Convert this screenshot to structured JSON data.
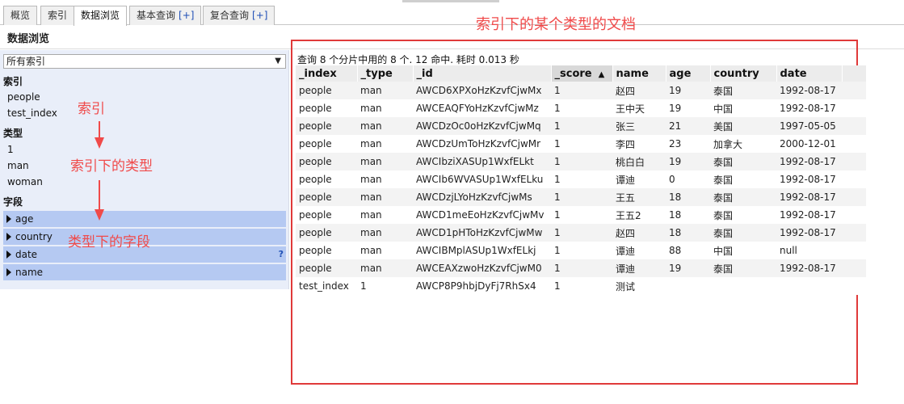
{
  "tabs": [
    {
      "label": "概览"
    },
    {
      "label": "索引"
    },
    {
      "label": "数据浏览"
    },
    {
      "label": "基本查询",
      "plus": "[+]"
    },
    {
      "label": "复合查询",
      "plus": "[+]"
    }
  ],
  "page_title": "数据浏览",
  "sidebar": {
    "index_select": "所有索引",
    "index_heading": "索引",
    "indices": [
      "people",
      "test_index"
    ],
    "type_heading": "类型",
    "types": [
      "1",
      "man",
      "woman"
    ],
    "field_heading": "字段",
    "fields": [
      "age",
      "country",
      "date",
      "name"
    ],
    "help_mark": "?"
  },
  "annotations": {
    "index": "索引",
    "type": "索引下的类型",
    "field": "类型下的字段",
    "documents": "索引下的某个类型的文档"
  },
  "results": {
    "query_info": "查询 8 个分片中用的 8 个. 12 命中. 耗时 0.013 秒",
    "sort_indicator": "▲",
    "columns": [
      "_index",
      "_type",
      "_id",
      "_score",
      "name",
      "age",
      "country",
      "date"
    ],
    "rows": [
      [
        "people",
        "man",
        "AWCD6XPXoHzKzvfCjwMx",
        "1",
        "赵四",
        "19",
        "泰国",
        "1992-08-17"
      ],
      [
        "people",
        "man",
        "AWCEAQFYoHzKzvfCjwMz",
        "1",
        "王中天",
        "19",
        "中国",
        "1992-08-17"
      ],
      [
        "people",
        "man",
        "AWCDzOc0oHzKzvfCjwMq",
        "1",
        "张三",
        "21",
        "美国",
        "1997-05-05"
      ],
      [
        "people",
        "man",
        "AWCDzUmToHzKzvfCjwMr",
        "1",
        "李四",
        "23",
        "加拿大",
        "2000-12-01"
      ],
      [
        "people",
        "man",
        "AWCIbziXASUp1WxfELkt",
        "1",
        "桃白白",
        "19",
        "泰国",
        "1992-08-17"
      ],
      [
        "people",
        "man",
        "AWCIb6WVASUp1WxfELku",
        "1",
        "谭迪",
        "0",
        "泰国",
        "1992-08-17"
      ],
      [
        "people",
        "man",
        "AWCDzjLYoHzKzvfCjwMs",
        "1",
        "王五",
        "18",
        "泰国",
        "1992-08-17"
      ],
      [
        "people",
        "man",
        "AWCD1meEoHzKzvfCjwMv",
        "1",
        "王五2",
        "18",
        "泰国",
        "1992-08-17"
      ],
      [
        "people",
        "man",
        "AWCD1pHToHzKzvfCjwMw",
        "1",
        "赵四",
        "18",
        "泰国",
        "1992-08-17"
      ],
      [
        "people",
        "man",
        "AWCIBMplASUp1WxfELkj",
        "1",
        "谭迪",
        "88",
        "中国",
        "null"
      ],
      [
        "people",
        "man",
        "AWCEAXzwoHzKzvfCjwM0",
        "1",
        "谭迪",
        "19",
        "泰国",
        "1992-08-17"
      ],
      [
        "test_index",
        "1",
        "AWCP8P9hbjDyFj7RhSx4",
        "1",
        "测试",
        "",
        "",
        ""
      ]
    ]
  }
}
